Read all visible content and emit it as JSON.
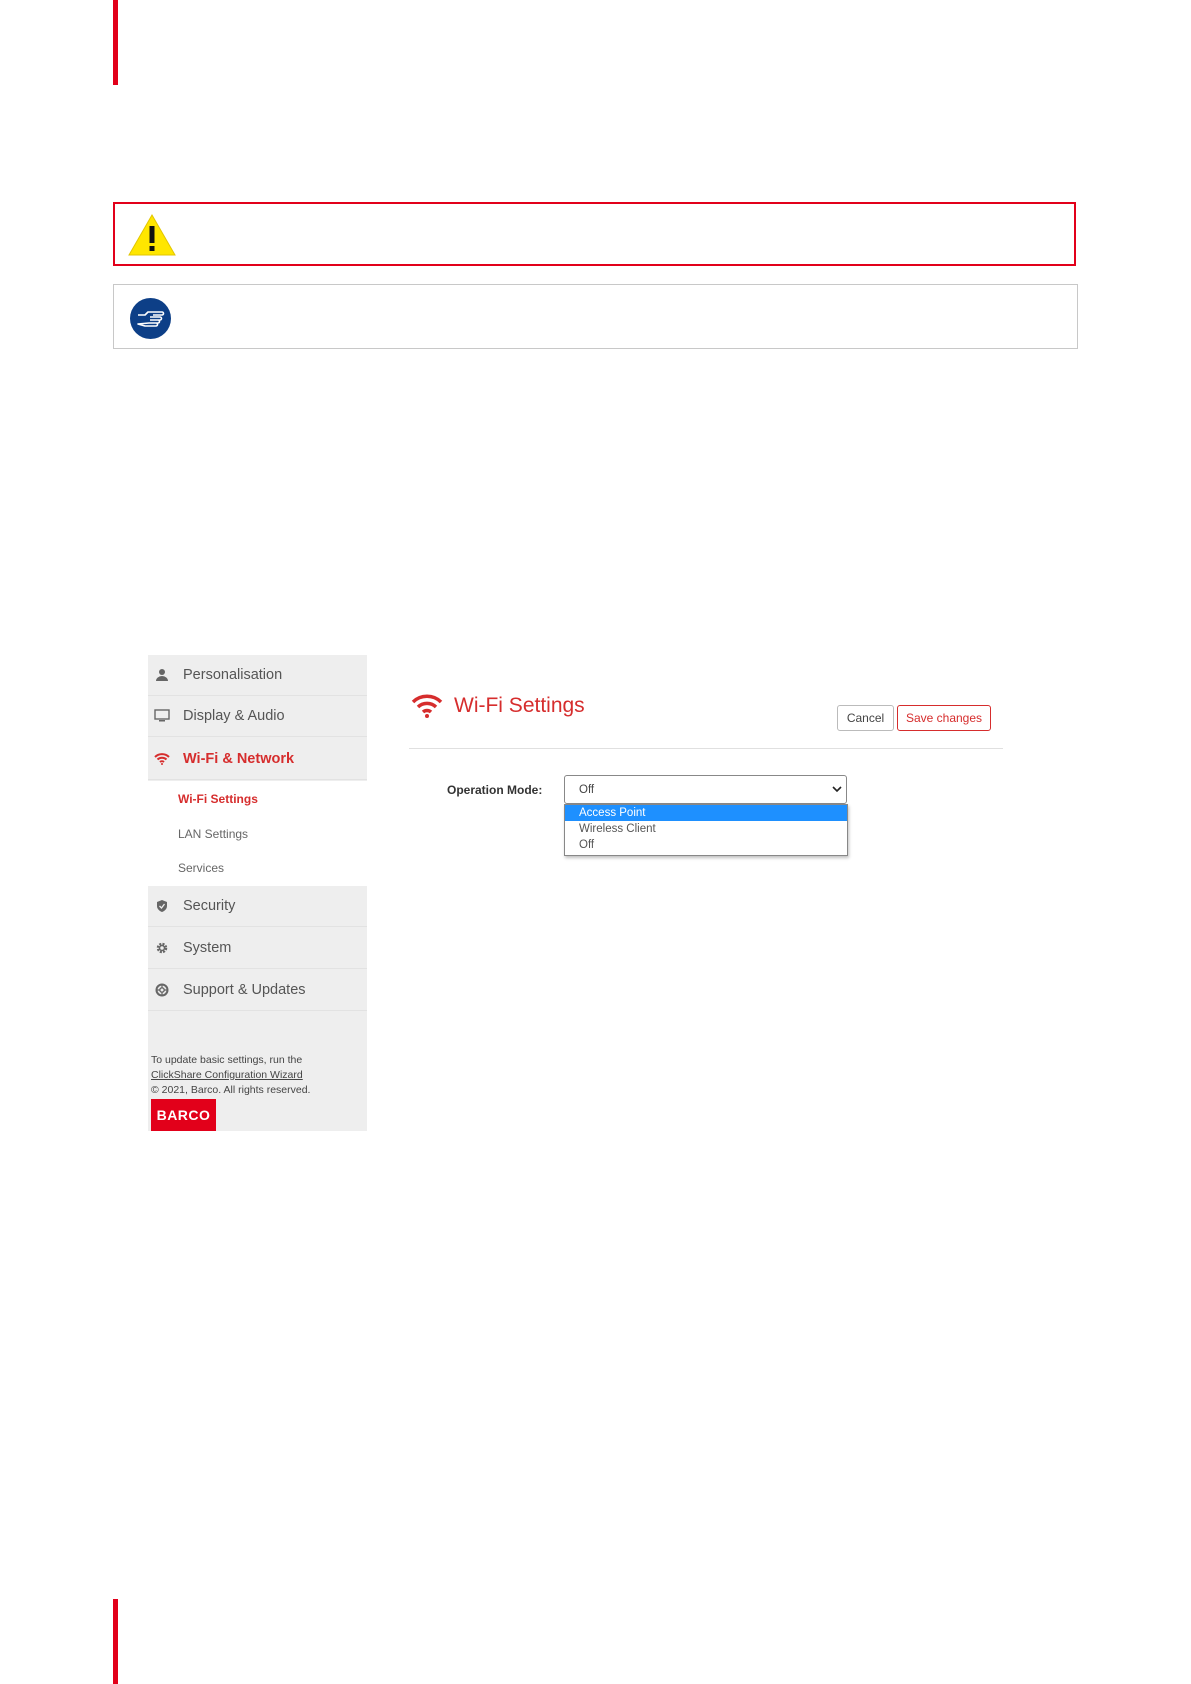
{
  "sidebar": {
    "items": [
      {
        "label": "Personalisation",
        "icon": "user-icon"
      },
      {
        "label": "Display & Audio",
        "icon": "monitor-icon"
      },
      {
        "label": "Wi-Fi & Network",
        "icon": "wifi-icon"
      },
      {
        "label": "Security",
        "icon": "shield-icon"
      },
      {
        "label": "System",
        "icon": "gear-icon"
      },
      {
        "label": "Support & Updates",
        "icon": "lifebuoy-icon"
      }
    ],
    "subitems": [
      {
        "label": "Wi-Fi Settings"
      },
      {
        "label": "LAN Settings"
      },
      {
        "label": "Services"
      }
    ],
    "footer": {
      "line1": "To update basic settings, run the",
      "link": "ClickShare Configuration Wizard",
      "copyright": "© 2021, Barco. All rights reserved.",
      "logo": "BARCO"
    }
  },
  "main": {
    "title": "Wi-Fi Settings",
    "cancel_label": "Cancel",
    "save_label": "Save changes",
    "operation_mode": {
      "label": "Operation Mode:",
      "value": "Off",
      "options": [
        "Access Point",
        "Wireless Client",
        "Off"
      ],
      "highlighted": "Access Point"
    }
  },
  "colors": {
    "accent": "#d62d2d",
    "barco_red": "#e2001a",
    "tip_blue": "#0d3f87",
    "warning_yellow": "#ffe600",
    "highlight": "#1e90ff"
  }
}
